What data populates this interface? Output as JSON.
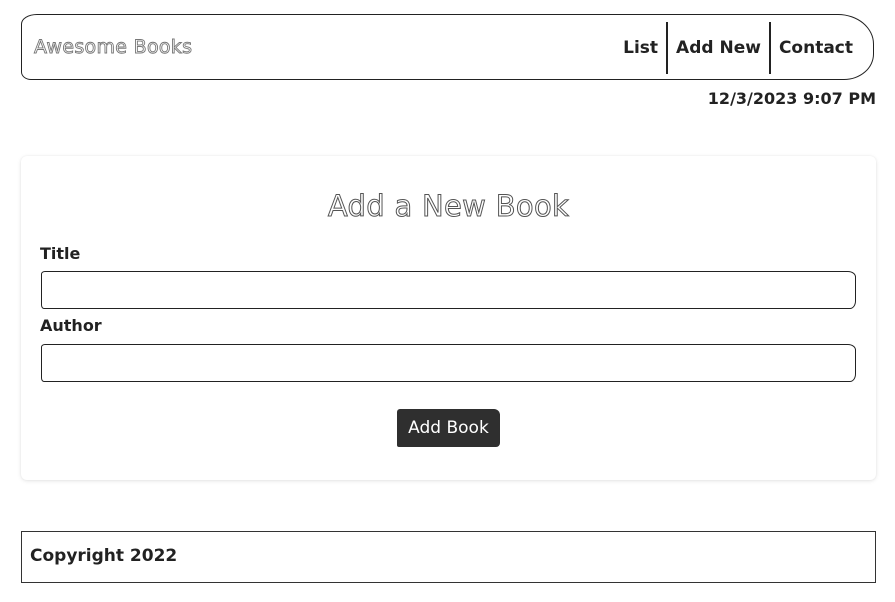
{
  "header": {
    "brand": "Awesome Books",
    "nav": [
      {
        "label": "List"
      },
      {
        "label": "Add New"
      },
      {
        "label": "Contact"
      }
    ],
    "datetime": "12/3/2023 9:07 PM"
  },
  "form": {
    "title": "Add a New Book",
    "title_label": "Title",
    "title_value": "",
    "author_label": "Author",
    "author_value": "",
    "submit_label": "Add Book"
  },
  "footer": {
    "copyright": "Copyright 2022"
  },
  "colors": {
    "button_bg": "#2f2f2f",
    "border": "#222222"
  }
}
